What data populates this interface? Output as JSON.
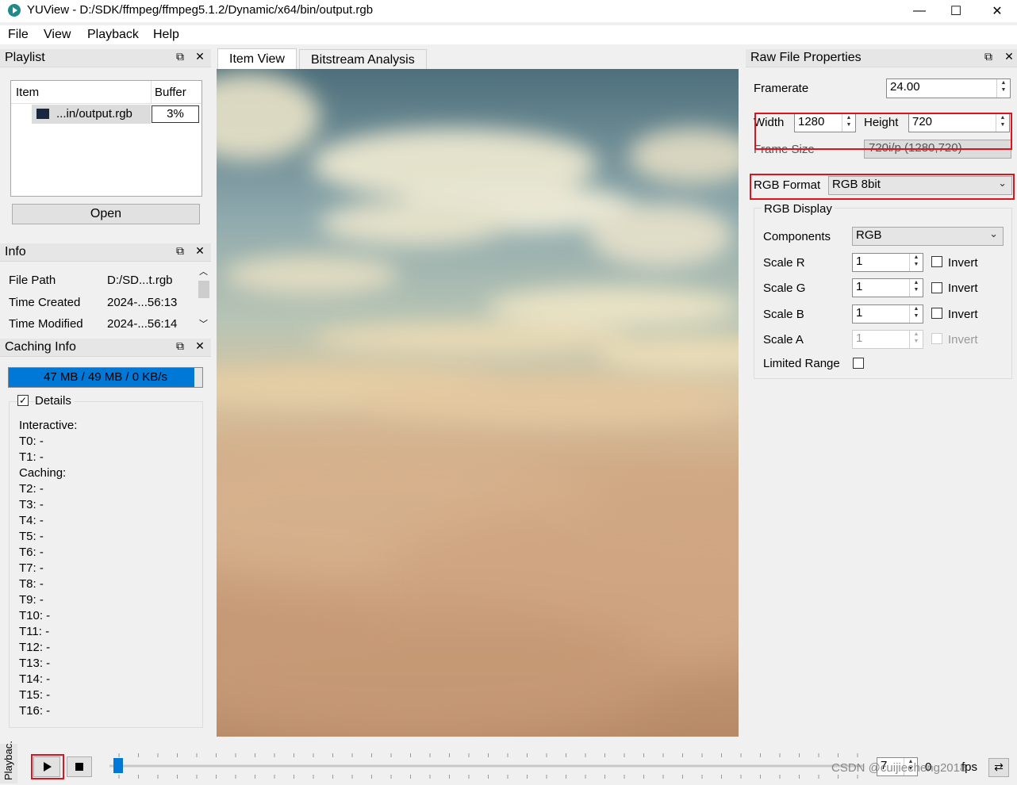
{
  "window": {
    "title": "YUView - D:/SDK/ffmpeg/ffmpeg5.1.2/Dynamic/x64/bin/output.rgb",
    "controls": [
      "—",
      "☐",
      "✕"
    ]
  },
  "menu": [
    "File",
    "View",
    "Playback",
    "Help"
  ],
  "playlist": {
    "title": "Playlist",
    "columns": [
      "Item",
      "Buffer"
    ],
    "item_name": "...in/output.rgb",
    "item_buffer": "3%",
    "open_label": "Open"
  },
  "info": {
    "title": "Info",
    "rows": [
      {
        "label": "File Path",
        "value": "D:/SD...t.rgb"
      },
      {
        "label": "Time Created",
        "value": "2024-...56:13"
      },
      {
        "label": "Time Modified",
        "value": "2024-...56:14"
      }
    ]
  },
  "caching": {
    "title": "Caching Info",
    "progress_text": "47 MB / 49 MB / 0 KB/s",
    "progress_fraction": 0.96,
    "details_label": "Details",
    "details_checked": true,
    "lines": [
      "Interactive:",
      "T0: -",
      "T1: -",
      "Caching:",
      "T2: -",
      "T3: -",
      "T4: -",
      "T5: -",
      "T6: -",
      "T7: -",
      "T8: -",
      "T9: -",
      "T10: -",
      "T11: -",
      "T12: -",
      "T13: -",
      "T14: -",
      "T15: -",
      "T16: -"
    ]
  },
  "tabs": [
    "Item View",
    "Bitstream Analysis"
  ],
  "props": {
    "title": "Raw File Properties",
    "framerate_label": "Framerate",
    "framerate": "24.00",
    "width_label": "Width",
    "width": "1280",
    "height_label": "Height",
    "height": "720",
    "frame_size_label": "Frame Size",
    "frame_size": "720i/p (1280,720)",
    "rgb_format_label": "RGB Format",
    "rgb_format": "RGB 8bit",
    "rgb_display_label": "RGB Display",
    "components_label": "Components",
    "components": "RGB",
    "scales": [
      {
        "label": "Scale R",
        "value": "1",
        "invert": "Invert",
        "enabled": true
      },
      {
        "label": "Scale G",
        "value": "1",
        "invert": "Invert",
        "enabled": true
      },
      {
        "label": "Scale B",
        "value": "1",
        "invert": "Invert",
        "enabled": true
      },
      {
        "label": "Scale A",
        "value": "1",
        "invert": "Invert",
        "enabled": false
      }
    ],
    "limited_range_label": "Limited Range"
  },
  "playback": {
    "side_label": "Playbac.",
    "fps_value": "7",
    "frame_value": "0",
    "fps_label": "fps",
    "watermark": "CSDN @cuijiecheng2018"
  },
  "colors": {
    "accent": "#0078d7",
    "highlight": "#e0131d"
  }
}
